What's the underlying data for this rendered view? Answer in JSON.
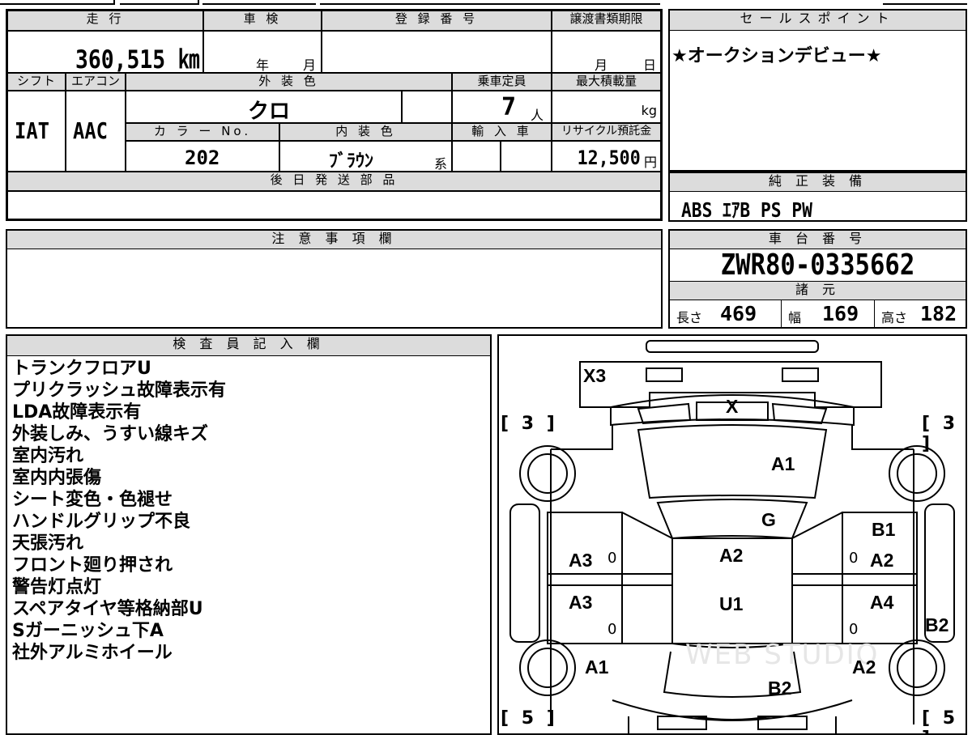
{
  "spec": {
    "mileage_header": "走 行",
    "mileage": "360,515 ㎞",
    "inspection_header": "車 検",
    "inspection_year_unit": "年",
    "inspection_month_unit": "月",
    "registration_header": "登 録 番 号",
    "transfer_header": "譲渡書類期限",
    "transfer_month_unit": "月",
    "transfer_day_unit": "日",
    "shift_header": "シフト",
    "shift": "IAT",
    "aircon_header": "エアコン",
    "aircon": "AAC",
    "exterior_color_header": "外 装 色",
    "exterior_color": "クロ",
    "capacity_header": "乗車定員",
    "capacity": "7",
    "capacity_unit": "人",
    "max_load_header": "最大積載量",
    "max_load_unit": "kg",
    "color_no_header": "カ ラ ー No.",
    "color_no": "202",
    "interior_color_header": "内 装 色",
    "interior_color": "ﾌﾞﾗｳﾝ",
    "interior_suffix": "系",
    "import_header": "輸 入 車",
    "recycle_header": "リサイクル預託金",
    "recycle_fee": "12,500",
    "recycle_unit": "円",
    "later_parts_header": "後 日 発 送 部 品"
  },
  "sales_point": {
    "header": "セールスポイント",
    "text": "★オークションデビュー★"
  },
  "equipment": {
    "header": "純 正 装 備",
    "text": "ABS ｴｱB PS PW"
  },
  "caution": {
    "header": "注 意 事 項 欄"
  },
  "chassis": {
    "header": "車 台 番 号",
    "number": "ZWR80-0335662"
  },
  "dimensions": {
    "header": "諸 元",
    "length_label": "長さ",
    "length": "469",
    "width_label": "幅",
    "width": "169",
    "height_label": "高さ",
    "height": "182"
  },
  "inspector": {
    "header": "検 査 員 記 入 欄",
    "notes": [
      "トランクフロアU",
      "プリクラッシュ故障表示有",
      "LDA故障表示有",
      "外装しみ、うすい線キズ",
      "室内汚れ",
      "室内内張傷",
      "シート変色・色褪せ",
      "ハンドルグリップ不良",
      "天張汚れ",
      "フロント廻り押され",
      "警告灯点灯",
      "スペアタイヤ等格納部U",
      "Sガーニッシュ下A",
      "社外アルミホイール"
    ]
  },
  "diagram": {
    "watermark": "WEB STUDIO",
    "labels": {
      "rear_bumper": "X3",
      "rear_glass": "X",
      "roof": "A1",
      "front_glass": "G",
      "hood_top": "A2",
      "hood_bottom": "U1",
      "front_bumper": "B2",
      "left_rear_door": "A3",
      "left_front_door": "A3",
      "left_front_fender": "A1",
      "right_rear_panel": "B1",
      "right_rear_door": "A2",
      "right_front_door": "A4",
      "right_sill": "B2",
      "right_front_fender": "A2",
      "tire_rear_left": "3",
      "tire_rear_right": "3",
      "tire_front_left": "5",
      "tire_front_right": "5",
      "zero": "0"
    }
  }
}
